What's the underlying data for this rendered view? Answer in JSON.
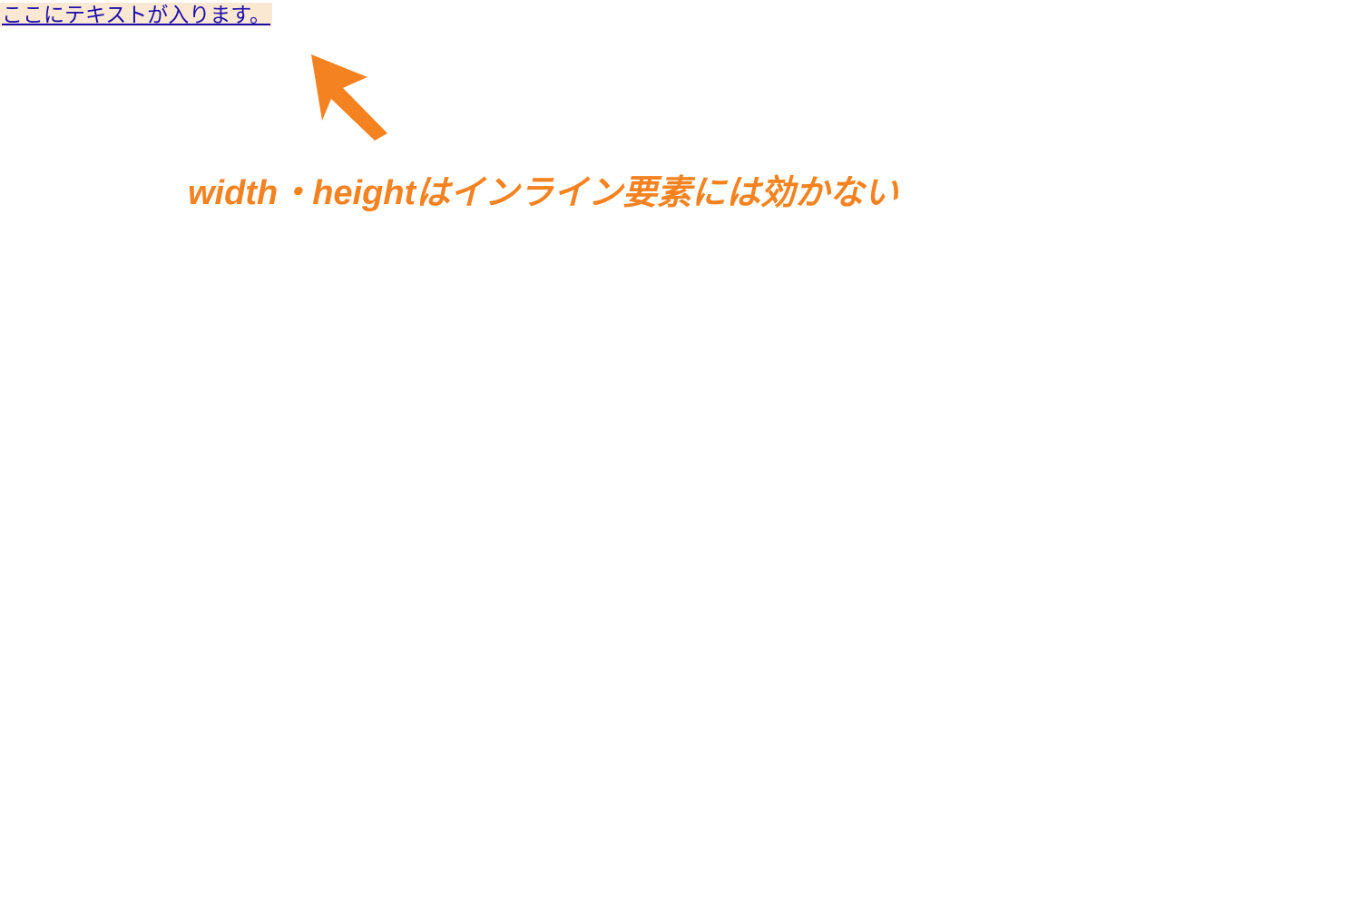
{
  "demo": {
    "link_text": "ここにテキストが入ります。"
  },
  "annotation": {
    "caption": "width・heightはインライン要素には効かない"
  },
  "colors": {
    "accent": "#f58220",
    "link": "#1a0dab",
    "highlight_bg": "#fbe8d3"
  }
}
